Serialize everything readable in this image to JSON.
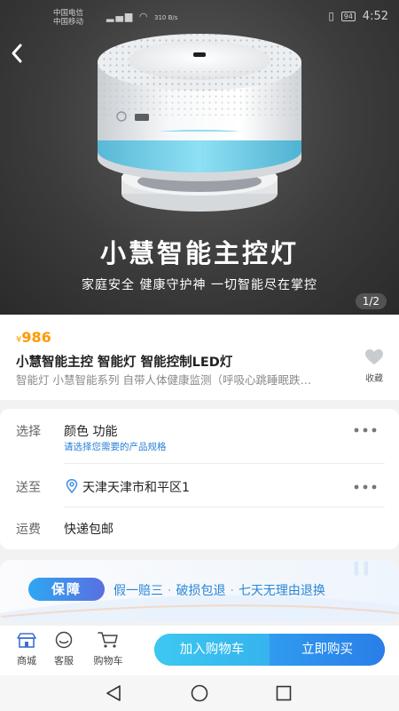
{
  "status_bar": {
    "carrier_1": "中国电信",
    "carrier_2": "中国移动",
    "net_speed": "310 B/s",
    "battery": "94",
    "time": "4:52"
  },
  "hero": {
    "title": "小慧智能主控灯",
    "subtitle": "家庭安全 健康守护神 一切智能尽在掌控",
    "page_indicator": "1/2"
  },
  "product": {
    "currency": "¥",
    "price": "986",
    "title": "小慧智能主控 智能灯 智能控制LED灯",
    "description": "智能灯 小慧智能系列 自带人体健康监测（呼吸心跳睡眠跌…",
    "favorite_label": "收藏"
  },
  "options": {
    "select_label": "选择",
    "select_value": "颜色 功能",
    "select_hint": "请选择您需要的产品规格",
    "ship_label": "送至",
    "ship_value": "天津天津市和平区1",
    "fee_label": "运费",
    "fee_value": "快递包邮"
  },
  "guarantee": {
    "badge": "保障",
    "items": [
      "假一赔三",
      "破损包退",
      "七天无理由退换"
    ]
  },
  "bottom_bar": {
    "shop": "商城",
    "service": "客服",
    "cart": "购物车",
    "add_to_cart": "加入购物车",
    "buy_now": "立即购买"
  },
  "colors": {
    "price": "#ff9a00",
    "accent_blue": "#2a86d6",
    "cta_start": "#34c6f1",
    "cta_end": "#2a7ee8",
    "hint_blue": "#2a7fd9"
  },
  "icons": [
    "back-arrow-icon",
    "heart-icon",
    "more-dots-icon",
    "location-pin-icon",
    "shop-icon",
    "service-icon",
    "cart-icon",
    "nav-back-icon",
    "nav-home-icon",
    "nav-recent-icon"
  ]
}
